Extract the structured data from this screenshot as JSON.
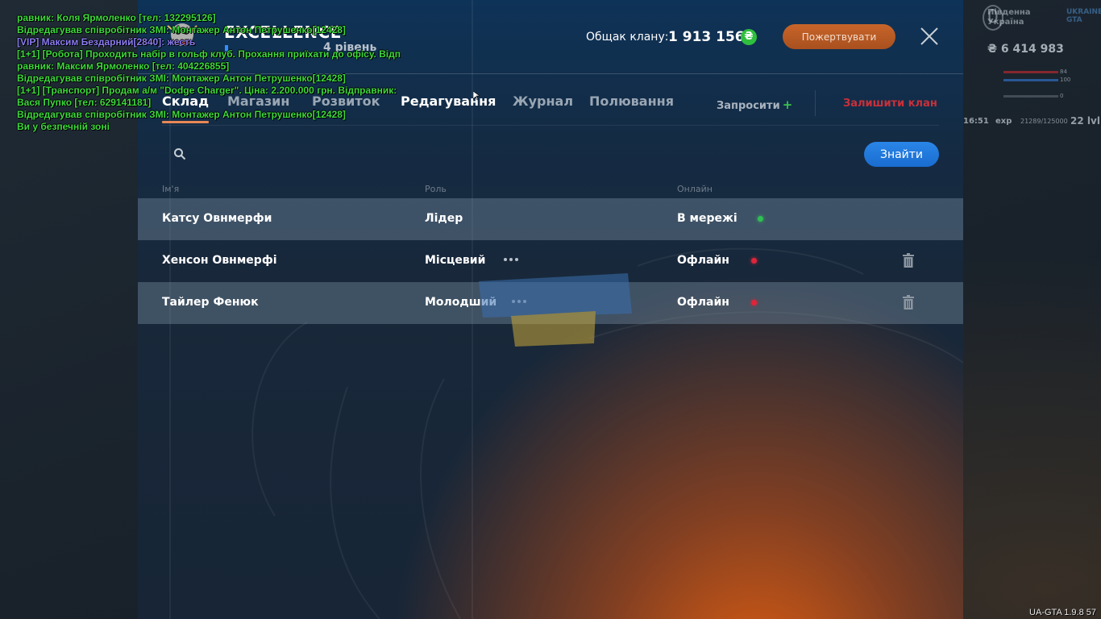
{
  "clan": {
    "name": "EXCELLENCE",
    "level": "4 рівень",
    "bank_label": "Общак клану:",
    "bank_value": "1 913 156",
    "currency_symbol": "₴",
    "donate_label": "Пожертвувати"
  },
  "tabs": [
    {
      "label": "Склад",
      "active": true
    },
    {
      "label": "Магазин"
    },
    {
      "label": "Розвиток"
    },
    {
      "label": "Редагування"
    },
    {
      "label": "Журнал"
    },
    {
      "label": "Полювання"
    }
  ],
  "actions": {
    "invite_label": "Запросити",
    "invite_plus": "+",
    "leave_label": "Залишити клан"
  },
  "search": {
    "placeholder": "",
    "button_label": "Знайти"
  },
  "table": {
    "headers": {
      "name": "Ім'я",
      "role": "Роль",
      "online": "Онлайн"
    },
    "rows": [
      {
        "name": "Катсу Овнмерфи",
        "role": "Лідер",
        "status": "В мережі",
        "status_color": "#2fbf55"
      },
      {
        "name": "Хенсон Овнмерфі",
        "role": "Місцевий",
        "status": "Офлайн",
        "status_color": "#e0243a"
      },
      {
        "name": "Тайлер Фенюк",
        "role": "Молодший",
        "status": "Офлайн",
        "status_color": "#e0243a"
      }
    ]
  },
  "chat": [
    {
      "text": "равник: Коля Ярмоленко [тел: 132295126]",
      "color": "#3ed93e"
    },
    {
      "text": " Відредагував співробітник ЗМІ: Монтажер Антон Петрушенко[12428]",
      "color": "#3ed93e"
    },
    {
      "text": " [VIP] Максим Бездарний[2840]: жесть",
      "color": "#8a7cf0"
    },
    {
      "text": "[1+1] [Робота] Проходить набір в гольф клуб. Прохання приїхати до офісу. Відп",
      "color": "#3ed93e"
    },
    {
      "text": "равник: Максим Ярмоленко [тел: 404226855]",
      "color": "#3ed93e"
    },
    {
      "text": " Відредагував співробітник ЗМІ: Монтажер Антон Петрушенко[12428]",
      "color": "#3ed93e"
    },
    {
      "text": "[1+1] [Транспорт] Продам а/м \"Dodge Charger\". Ціна: 2.200.000 грн. Відправник:",
      "color": "#3ed93e"
    },
    {
      "text": " Вася Пупко [тел: 629141181]",
      "color": "#3ed93e"
    },
    {
      "text": " Відредагував співробітник ЗМІ: Монтажер Антон Петрушенко[12428]",
      "color": "#3ed93e"
    },
    {
      "text": "Ви у безпечній зоні",
      "color": "#3ed93e"
    }
  ],
  "hud": {
    "logo_text": "Південна\nУкраїна",
    "logo_badge": "UKRAINE GTA",
    "money": "₴ 6 414 983",
    "health_value": "84",
    "armor_value": "100",
    "hunger_value": "0",
    "time": "16:51",
    "exp_label": "exp",
    "exp_value": "21289/125000",
    "level": "22 lvl"
  },
  "version": "UA-GTA 1.9.8 57",
  "colors": {
    "accent_blue": "#1f77dc",
    "tab_underline": "#e88756",
    "leave_red": "#c9303a",
    "donate_orange": "#b85a25"
  }
}
